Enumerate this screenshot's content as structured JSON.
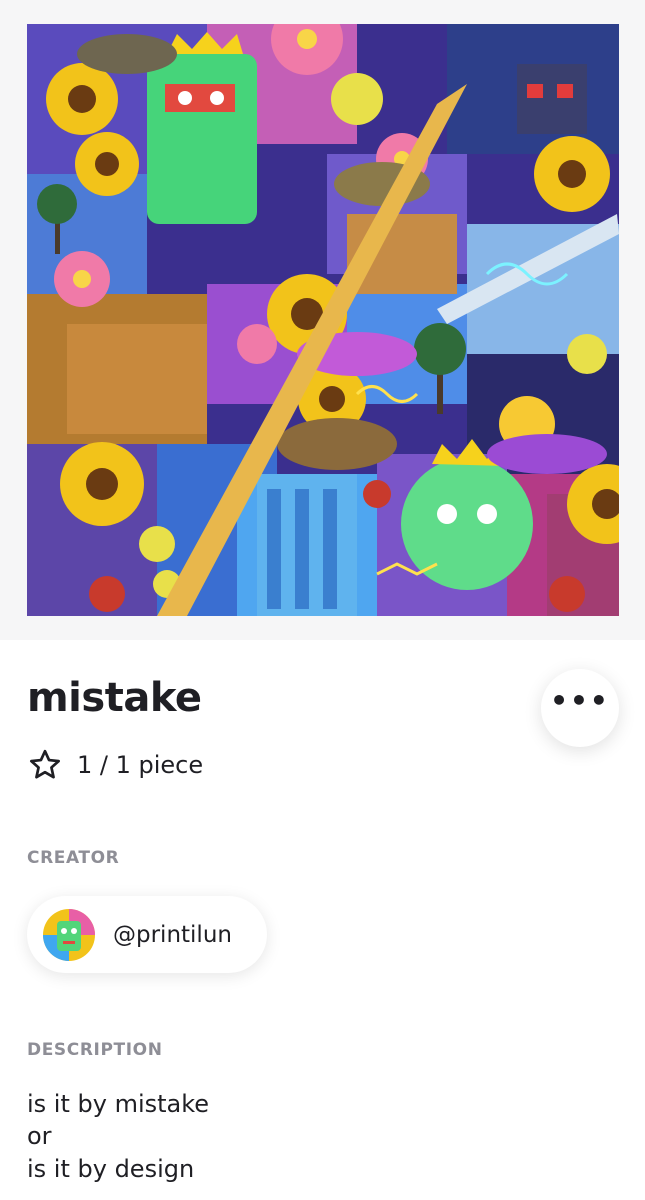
{
  "artwork": {
    "palette": [
      "#3d2f8c",
      "#f2c31a",
      "#7a48d4",
      "#e85fa6",
      "#52d57a",
      "#b7792f",
      "#3fa7f0"
    ]
  },
  "nft": {
    "title": "mistake",
    "edition": "1 / 1 piece"
  },
  "actions": {
    "more_label": "•••"
  },
  "creator": {
    "section_label": "CREATOR",
    "handle": "@printilun"
  },
  "description": {
    "section_label": "DESCRIPTION",
    "lines": [
      "is it by mistake",
      "or",
      "is it by design"
    ]
  }
}
